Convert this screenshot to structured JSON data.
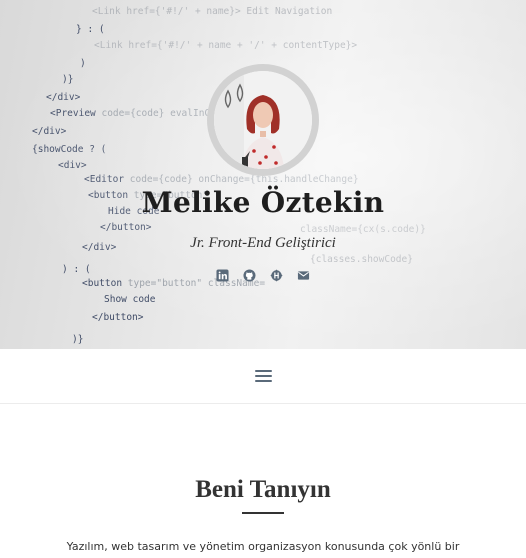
{
  "profile": {
    "name": "Melike Öztekin",
    "role": "Jr. Front-End Geliştirici"
  },
  "socials": [
    {
      "name": "linkedin",
      "icon": "linkedin-icon"
    },
    {
      "name": "github",
      "icon": "github-icon"
    },
    {
      "name": "hashnode",
      "icon": "hashnode-icon"
    },
    {
      "name": "email",
      "icon": "envelope-icon"
    }
  ],
  "navbar": {
    "menu_icon": "hamburger-menu-icon"
  },
  "about": {
    "title": "Beni Tanıyın",
    "text": "Yazılım, web tasarım ve yönetim organizasyon konusunda çok yönlü bir"
  },
  "colors": {
    "icon": "#5a6a7a",
    "text_dark": "#333333",
    "avatar_ring": "#d2d2d2"
  }
}
